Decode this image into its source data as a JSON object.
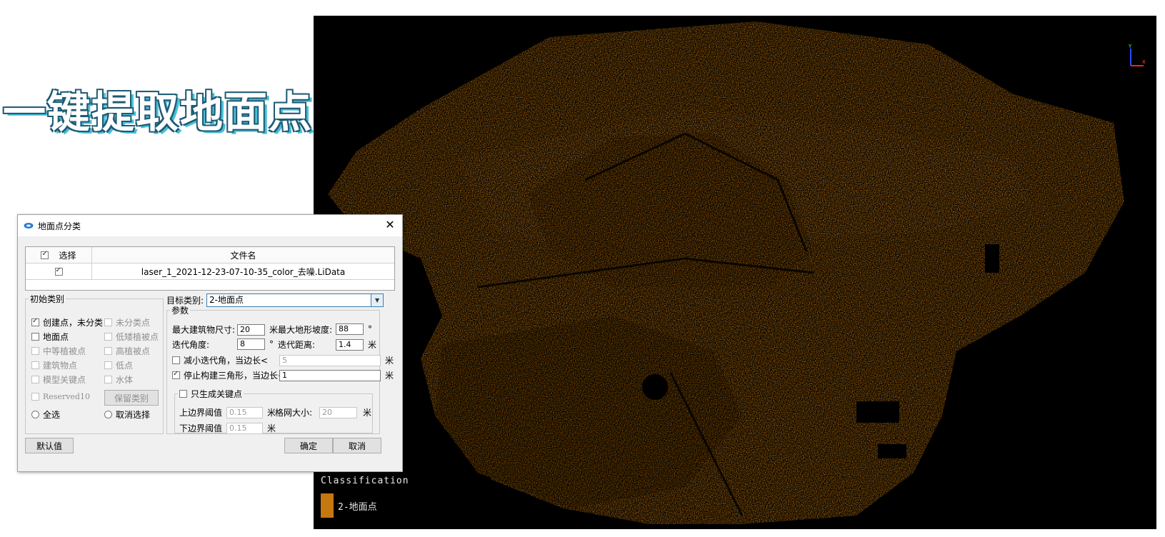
{
  "headline": "一键提取地面点",
  "viewer": {
    "classification_title": "Classification",
    "legend_label": "2-地面点",
    "point_color": "#c57710",
    "axis": {
      "y": "Y",
      "x": "X"
    }
  },
  "dialog": {
    "title": "地面点分类",
    "close": "✕",
    "table": {
      "col_select": "选择",
      "col_filename": "文件名",
      "rows": [
        {
          "checked": true,
          "filename": "laser_1_2021-12-23-07-10-35_color_去噪.LiData"
        }
      ]
    },
    "initial_class": {
      "legend": "初始类别",
      "items": [
        {
          "label": "创建点，未分类",
          "checked": true,
          "enabled": true
        },
        {
          "label": "未分类点",
          "checked": false,
          "enabled": false
        },
        {
          "label": "地面点",
          "checked": false,
          "enabled": true
        },
        {
          "label": "低矮植被点",
          "checked": false,
          "enabled": false
        },
        {
          "label": "中等植被点",
          "checked": false,
          "enabled": false
        },
        {
          "label": "高植被点",
          "checked": false,
          "enabled": false
        },
        {
          "label": "建筑物点",
          "checked": false,
          "enabled": false
        },
        {
          "label": "低点",
          "checked": false,
          "enabled": false
        },
        {
          "label": "模型关键点",
          "checked": false,
          "enabled": false
        },
        {
          "label": "水体",
          "checked": false,
          "enabled": false
        },
        {
          "label": "Reserved10",
          "checked": false,
          "enabled": false
        }
      ],
      "keep_class": "保留类别",
      "select_all": "全选",
      "deselect": "取消选择"
    },
    "target": {
      "label": "目标类别:",
      "value": "2-地面点"
    },
    "params": {
      "legend": "参数",
      "max_building_label": "最大建筑物尺寸:",
      "max_building_value": "20",
      "max_slope_label": "最大地形坡度:",
      "max_slope_value": "88",
      "iter_angle_label": "迭代角度:",
      "iter_angle_value": "8",
      "iter_dist_label": "迭代距离:",
      "iter_dist_value": "1.4",
      "reduce_label": "减小迭代角，当边长<",
      "reduce_value": "5",
      "reduce_checked": false,
      "stop_label": "停止构建三角形，当边长<",
      "stop_value": "1",
      "stop_checked": true,
      "unit_m": "米",
      "unit_deg": "°",
      "keypoints": {
        "legend": "只生成关键点",
        "checked": false,
        "upper_label": "上边界阈值",
        "upper_value": "0.15",
        "grid_label": "格网大小:",
        "grid_value": "20",
        "lower_label": "下边界阈值",
        "lower_value": "0.15"
      }
    },
    "buttons": {
      "default": "默认值",
      "ok": "确定",
      "cancel": "取消"
    }
  }
}
